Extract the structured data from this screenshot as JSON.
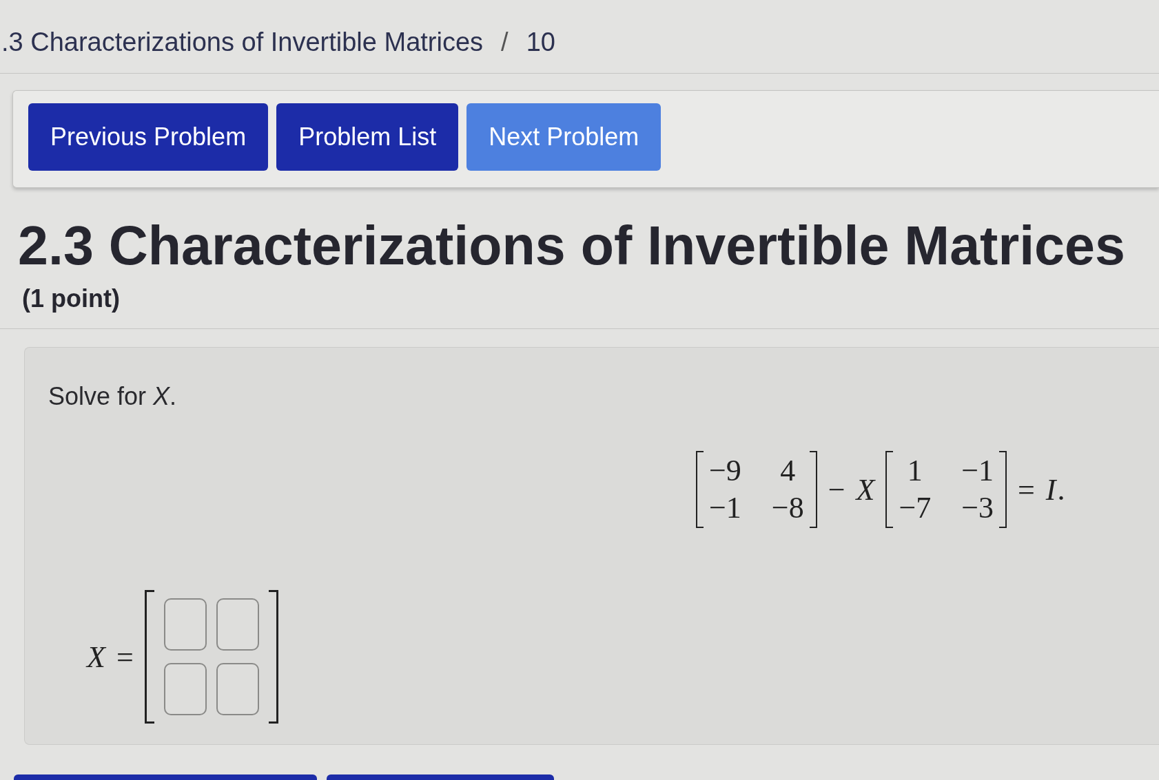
{
  "breadcrumb": {
    "section": ".3 Characterizations of Invertible Matrices",
    "separator": "/",
    "problem": "10"
  },
  "nav_buttons": [
    {
      "label": "Previous Problem",
      "disabled": false
    },
    {
      "label": "Problem List",
      "disabled": false
    },
    {
      "label": "Next Problem",
      "disabled": true
    }
  ],
  "problem": {
    "title": "2.3 Characterizations of Invertible Matrices",
    "points": "(1 point)",
    "prompt": "Solve for *X*.",
    "equation": [
      {
        "kind": "matrix",
        "rows": [
          [
            "−9",
            "4"
          ],
          [
            "−1",
            "−8"
          ]
        ]
      },
      {
        "kind": "op",
        "text": "−"
      },
      {
        "kind": "var",
        "text": "X"
      },
      {
        "kind": "matrix",
        "rows": [
          [
            "1",
            "−1"
          ],
          [
            "−7",
            "−3"
          ]
        ]
      },
      {
        "kind": "op",
        "text": "="
      },
      {
        "kind": "var",
        "text": "I"
      },
      {
        "kind": "punct",
        "text": "."
      }
    ],
    "answer": [
      {
        "kind": "var",
        "text": "X"
      },
      {
        "kind": "op",
        "text": "="
      },
      {
        "kind": "blank_matrix",
        "rows": [
          [
            {
              "kind": "input"
            },
            {
              "kind": "input"
            }
          ],
          [
            {
              "kind": "input"
            },
            {
              "kind": "input"
            }
          ]
        ]
      }
    ]
  },
  "footer_buttons": [
    {
      "kind": "cut_off"
    },
    {
      "kind": "cut_off"
    }
  ]
}
